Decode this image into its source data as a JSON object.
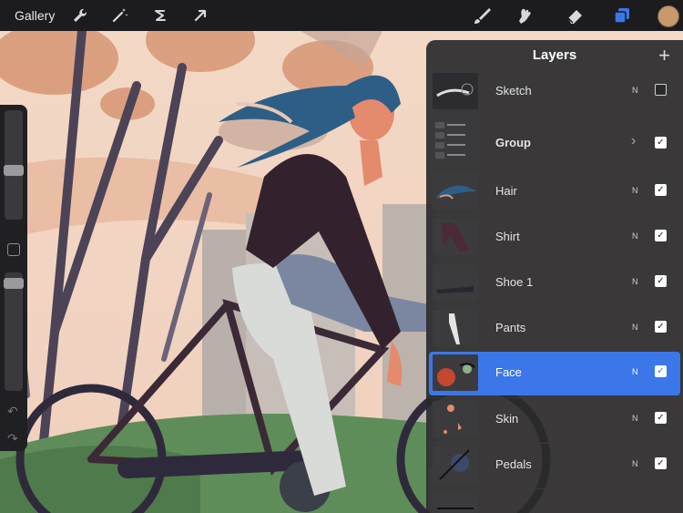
{
  "topbar": {
    "gallery_label": "Gallery",
    "left_icons": [
      "wrench-icon",
      "magic-wand-icon",
      "selection-icon",
      "transform-arrow-icon"
    ],
    "right_icons": [
      "brush-icon",
      "smudge-icon",
      "eraser-icon",
      "layers-icon",
      "color-swatch"
    ]
  },
  "colors": {
    "accent": "#3b77e9",
    "panel_bg": "#2a2a2c",
    "current_color": "#c9996b"
  },
  "layers_panel": {
    "title": "Layers",
    "add_icon": "plus-icon",
    "layers": [
      {
        "name": "Sketch",
        "blend": "N",
        "visible": false
      },
      {
        "name": "Group",
        "blend": "",
        "visible": true,
        "group": true
      },
      {
        "name": "Hair",
        "blend": "N",
        "visible": true
      },
      {
        "name": "Shirt",
        "blend": "N",
        "visible": true
      },
      {
        "name": "Shoe 1",
        "blend": "N",
        "visible": true
      },
      {
        "name": "Pants",
        "blend": "N",
        "visible": true
      },
      {
        "name": "Face",
        "blend": "N",
        "visible": true,
        "selected": true
      },
      {
        "name": "Skin",
        "blend": "N",
        "visible": true
      },
      {
        "name": "Pedals",
        "blend": "N",
        "visible": true
      }
    ]
  }
}
